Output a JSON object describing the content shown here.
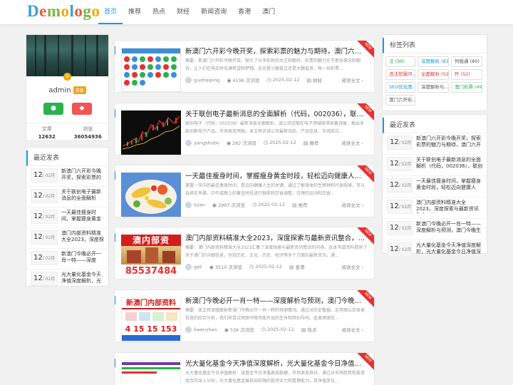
{
  "header": {
    "logo": "Demologo",
    "nav": [
      "首页",
      "推荐",
      "热点",
      "财经",
      "新闻咨询",
      "香港",
      "澳门"
    ]
  },
  "profile": {
    "name": "admin",
    "badge": "游客",
    "stats": [
      {
        "label": "文章",
        "value": "12632"
      },
      {
        "label": "浏览",
        "value": "36054936"
      }
    ]
  },
  "left_recent": {
    "title": "最近发表",
    "items": [
      {
        "day": "12",
        "month": "/ 02月",
        "title": "新澳门六开彩今晚开奖，探索彩票的"
      },
      {
        "day": "12",
        "month": "/ 02月",
        "title": "关于联创电子最新消息的全面解析"
      },
      {
        "day": "12",
        "month": "/ 02月",
        "title": "一天最佳瘦身时间，掌握瘦身黄金"
      },
      {
        "day": "12",
        "month": "/ 02月",
        "title": "澳门内部资料精准大全2023，深度探"
      },
      {
        "day": "12",
        "month": "/ 02月",
        "title": "新澳门今晚必开一肖一特——深度"
      },
      {
        "day": "12",
        "month": "/ 02月",
        "title": "光大量化基金今天净值深度解析，光"
      }
    ]
  },
  "articles": [
    {
      "title": "新澳门六开彩今晚开奖，探索彩票的魅力与期待，澳门六开彩...",
      "excerpt": "摘要：新澳门六开彩今晚开奖，吸引了众多彩民的关注和期待，彩票的魅力在于那份悬念和期待，让人们在购买时充满希望和梦想。无论是小额投注还是大额投资，每一份彩票...",
      "author": "guohaiping",
      "views": "4196 次浏览",
      "date": "2025-02-12",
      "category": "财经",
      "read": "阅读全文",
      "ribbon": "NEW"
    },
    {
      "title": "关于联创电子最新消息的全面解析（代码，002036），联创电...",
      "excerpt": "联创电子（代码：002036）最新消息全面解析。该公司近期在电子领域取得显著进展，推出多款创新电子产品。市场表现亮眼，本文将对该公司最新动态、产品信息、市场反应...",
      "author": "yangshubo",
      "views": "282 次浏览",
      "date": "2025-02-12",
      "category": "推荐",
      "read": "阅读全文",
      "ribbon": "NEW"
    },
    {
      "title": "一天最佳瘦身时间，掌握瘦身黄金时段，轻松迈向健康人生，...",
      "excerpt": "掌握一天中的最佳瘦身时间，是迈向健康人生的关键。通过了解身体的生物钟和代谢规律，可以选择在早晨、中午或晚上的黄金时段进行锻炼和饮食调整，合理的运动和饮食...",
      "author": "lulan",
      "views": "2997 次浏览",
      "date": "2025-02-12",
      "category": "推荐",
      "read": "阅读全文",
      "ribbon": "NEW"
    },
    {
      "title": "澳门内部资料精准大全2023，深度探索与最新资讯整合，澳门...",
      "excerpt": "摘要：澳门内部资料精准大全2023汇集了深度探索与最新资讯整合的内容。这本书或资料提供了关于澳门的详细信息，包括历史、文化、历史、经济等多个方面的最新资讯。通...",
      "author": "geli",
      "views": "3510 次浏览",
      "date": "2025-02-12",
      "category": "香港",
      "read": "阅读全文",
      "ribbon": "NEW"
    },
    {
      "title": "新澳门今晚必开一肖一特——深度解析与预测，澳门今晚生肖...",
      "excerpt": "摘要：本文将深度解析新澳门今晚必开一肖一特的预测情况。通过对历史数据、走势图以及各类信息的综合分析，我们将尝试预测今晚可能开出的生肖和特别号码。此类预测仅...",
      "author": "liwenzhen",
      "views": "536 次浏览",
      "date": "2025-02-12",
      "category": "热点",
      "read": "阅读全文",
      "ribbon": "NEW"
    },
    {
      "title": "光大量化基金今天净值深度解析，光大量化基金今日净值深度...",
      "excerpt": "光大量化基金今日净值解析：该基金今日净值表现稳健，市场表现良好。通过对市场趋势和投资组合的深入分析，光大量化基金展现出较强的投资实力和管理能力。其净值变化...",
      "author": "",
      "views": "",
      "date": "",
      "category": "",
      "read": "",
      "ribbon": "NEW"
    }
  ],
  "thumbs": {
    "t3_label": "澳内部资",
    "t3_number": "85537484",
    "t4_header": "新澳门内部资料",
    "t4_number": "4 15 15 153"
  },
  "tags": {
    "title": "标签列表",
    "items": [
      {
        "label": "法 (98)",
        "color": "#2bb24c"
      },
      {
        "label": "深度解析 (83)",
        "color": "#1a9ad6"
      },
      {
        "label": "列极通 (80)",
        "color": "#555555"
      },
      {
        "label": "违法犯罪问...",
        "color": "#e8302f"
      },
      {
        "label": "全面解析 (52)",
        "color": "#e8302f"
      },
      {
        "label": "歼 (52)",
        "color": "#e8302f"
      },
      {
        "label": "SEO优化策...",
        "color": "#1a9ad6"
      },
      {
        "label": "深度解析与...",
        "color": "#555555"
      },
      {
        "label": "澳门彩票 (49)",
        "color": "#2bb24c"
      },
      {
        "label": "澳门六开彩...",
        "color": "#555555"
      }
    ]
  },
  "right_recent": {
    "title": "最近发表",
    "items": [
      {
        "day": "12",
        "month": "/ 02月",
        "title": "新澳门六开彩今晚开奖，探索彩票的魅力与期待，澳门六开"
      },
      {
        "day": "12",
        "month": "/ 02月",
        "title": "关于联创电子最新消息的全面解析（代码，002036），联创"
      },
      {
        "day": "12",
        "month": "/ 02月",
        "title": "一天最佳瘦身时间，掌握瘦身黄金时段，轻松迈向健康人"
      },
      {
        "day": "12",
        "month": "/ 02月",
        "title": "澳门内部资料精准大全2023，深度探索与最新资讯整合，澳"
      },
      {
        "day": "12",
        "month": "/ 02月",
        "title": "新澳门今晚必开一肖一特——深度解析与预测，澳门今晚生"
      },
      {
        "day": "12",
        "month": "/ 02月",
        "title": "光大量化基金今天净值深度解析，光大量化基金今日净值深"
      }
    ]
  },
  "colors": {
    "accent": "#1a9ad6",
    "ribbon": "#e8302f"
  }
}
